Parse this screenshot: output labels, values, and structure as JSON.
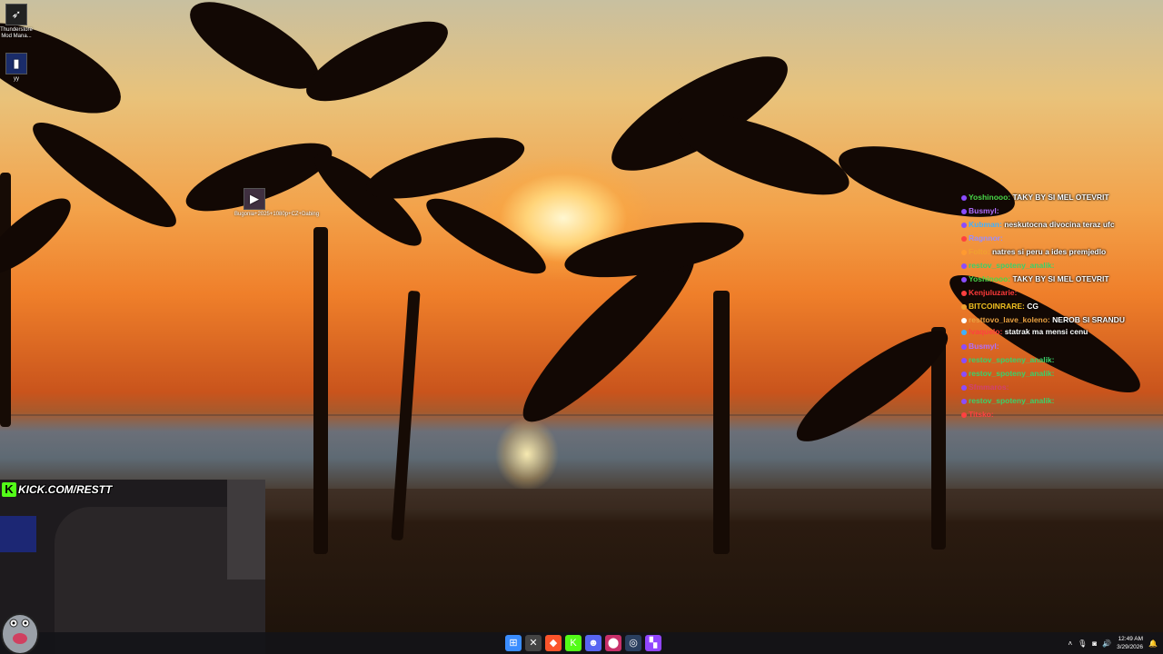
{
  "desktop": {
    "icons": [
      {
        "label": "Thunderstore Mod Mana...",
        "glyph": "➶",
        "icon": "thunderstore-icon"
      },
      {
        "label": "yy",
        "glyph": "▮",
        "icon": "app-icon"
      },
      {
        "label": "Bugonia+2025+1080p+CZ+Dabing",
        "glyph": "▶",
        "icon": "video-file-icon"
      }
    ]
  },
  "chat": [
    {
      "name": "Yoshinooo:",
      "text": "TAKY BY SI MEL OTEVRIT",
      "color": "#48d848",
      "badge": "#8a4cff"
    },
    {
      "name": "Busmyl:",
      "text": "",
      "color": "#b06cff",
      "badge": "#8a4cff"
    },
    {
      "name": "Kubman:",
      "text": "neskutocna divocina teraz ufc",
      "color": "#3fb0ff",
      "badge": "#8a4cff"
    },
    {
      "name": "Ragnnor:",
      "text": "",
      "color": "#9a8cff",
      "badge": "#ff4040"
    },
    {
      "name": "Folto:",
      "text": "natres si peru a ides premjedlo",
      "color": "#f0a030",
      "badge": "#ff9a30"
    },
    {
      "name": "restov_spoteny_analik:",
      "text": "",
      "color": "#39d26a",
      "badge": "#8a4cff"
    },
    {
      "name": "Yoshinooo:",
      "text": "TAKY BY SI MEL OTEVRIT",
      "color": "#48d848",
      "badge": "#8a4cff"
    },
    {
      "name": "Kenjuluzarie:",
      "text": "",
      "color": "#ff3a3a",
      "badge": "#ff4040"
    },
    {
      "name": "BITCOINRARE:",
      "text": "CG",
      "color": "#f0c020",
      "badge": "#f0a030"
    },
    {
      "name": "resttovo_lave_koleno:",
      "text": "NEROB SI SRANDU",
      "color": "#e8a040",
      "badge": "#ffffff"
    },
    {
      "name": "Ivaquelo:",
      "text": "statrak ma mensi cenu",
      "color": "#ff4040",
      "badge": "#3fb0ff"
    },
    {
      "name": "Busmyl:",
      "text": "",
      "color": "#b06cff",
      "badge": "#8a4cff"
    },
    {
      "name": "restov_spoteny_analik:",
      "text": "",
      "color": "#39d26a",
      "badge": "#8a4cff"
    },
    {
      "name": "restov_spoteny_analik:",
      "text": "",
      "color": "#39d26a",
      "badge": "#8a4cff"
    },
    {
      "name": "Sfmmaros:",
      "text": "",
      "color": "#d04070",
      "badge": "#8a4cff"
    },
    {
      "name": "restov_spoteny_analik:",
      "text": "",
      "color": "#39d26a",
      "badge": "#8a4cff"
    },
    {
      "name": "Titsko:",
      "text": "",
      "color": "#ff4040",
      "badge": "#ff4040"
    }
  ],
  "stream": {
    "kick_logo": "K",
    "kick_url": "KICK.COM/RESTT"
  },
  "taskbar": {
    "apps": [
      {
        "name": "start-icon",
        "glyph": "⊞",
        "color": "#3a8dff"
      },
      {
        "name": "file-explorer-icon",
        "glyph": "✕",
        "color": "#444"
      },
      {
        "name": "brave-browser-icon",
        "glyph": "◆",
        "color": "#fb542b"
      },
      {
        "name": "kick-app-icon",
        "glyph": "K",
        "color": "#53fc18"
      },
      {
        "name": "discord-icon",
        "glyph": "☻",
        "color": "#5865f2"
      },
      {
        "name": "maps-pin-icon",
        "glyph": "⬤",
        "color": "#c8306a"
      },
      {
        "name": "steam-icon",
        "glyph": "◎",
        "color": "#2a3f5f"
      },
      {
        "name": "twitch-icon",
        "glyph": "▚",
        "color": "#9146ff"
      }
    ],
    "tray": {
      "chevron": "˄",
      "mic": "🎙",
      "wifi": "◙",
      "volume": "🔊",
      "time": "12:49 AM",
      "date": "3/29/2026",
      "notif": "🔔"
    }
  }
}
